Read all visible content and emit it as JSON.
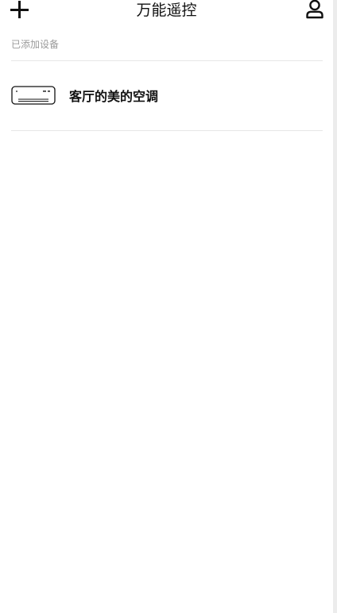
{
  "header": {
    "title": "万能遥控",
    "add_icon": "plus-icon",
    "profile_icon": "user-icon"
  },
  "devices_section": {
    "label": "已添加设备",
    "devices": [
      {
        "name": "客厅的美的空调",
        "icon": "air-conditioner-icon"
      }
    ]
  },
  "colors": {
    "background": "#ffffff",
    "text": "#111111",
    "muted_text": "#9a9a9a",
    "divider": "#e6e6e6"
  }
}
